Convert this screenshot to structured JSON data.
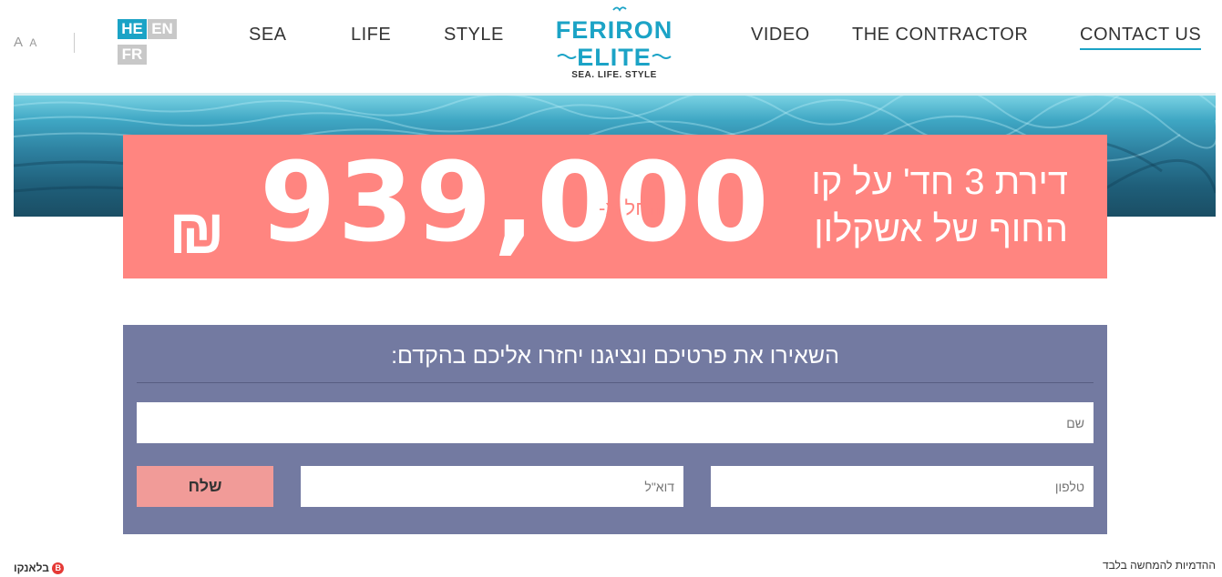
{
  "header": {
    "font_size_control": {
      "large": "A",
      "small": "A"
    },
    "languages": {
      "he": "HE",
      "en": "EN",
      "fr": "FR"
    },
    "nav": {
      "sea": "SEA",
      "life": "LIFE",
      "style": "STYLE",
      "video": "VIDEO",
      "contractor": "THE CONTRACTOR",
      "contact": "CONTACT US"
    },
    "logo": {
      "line1": "FERIRON",
      "line2": "ELITE",
      "tagline": "SEA. LIFE. STYLE"
    }
  },
  "promo": {
    "title_line1": "דירת 3 חד' על קו",
    "title_line2": "החוף של אשקלון",
    "from_label": "החל מ-",
    "price": "939,000",
    "currency": "₪"
  },
  "form": {
    "title": "השאירו את פרטיכם ונציגנו יחזרו אליכם בהקדם:",
    "name_placeholder": "שם",
    "phone_placeholder": "טלפון",
    "email_placeholder": "דוא\"ל",
    "submit_label": "שלח"
  },
  "footer": {
    "disclaimer": "ההדמיות להמחשה בלבד",
    "brand": "בלאנקו",
    "brand_mark": "B"
  },
  "colors": {
    "accent": "#1ba3c6",
    "promo_bg": "#ff8580",
    "form_bg": "#737aa1",
    "submit_bg": "#f19b98"
  }
}
